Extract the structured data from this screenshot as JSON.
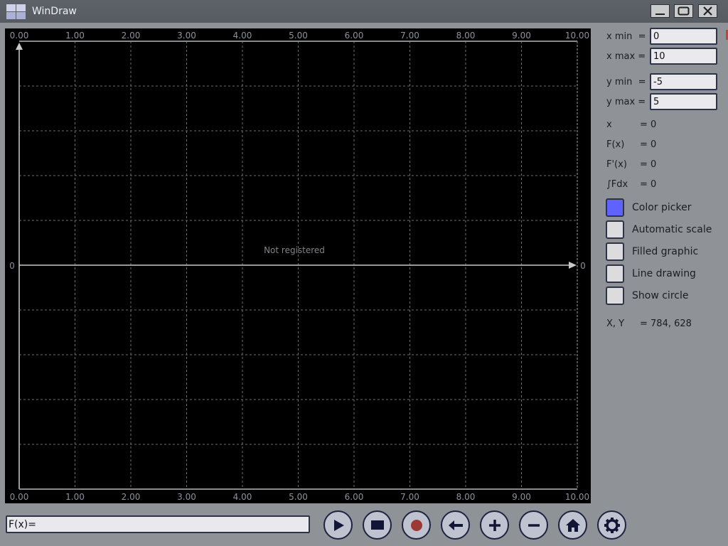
{
  "window": {
    "title": "WinDraw",
    "icon": "app-grid-icon",
    "controls": [
      {
        "name": "minimize",
        "icon": "minimize-icon"
      },
      {
        "name": "maximize",
        "icon": "maximize-icon"
      },
      {
        "name": "close",
        "icon": "close-icon"
      }
    ]
  },
  "plot": {
    "watermark": "Not registered",
    "x_ticks_top": [
      "0.00",
      "1.00",
      "2.00",
      "3.00",
      "4.00",
      "5.00",
      "6.00",
      "7.00",
      "8.00",
      "9.00",
      "10.00"
    ],
    "x_ticks_bottom": [
      "0.00",
      "1.00",
      "2.00",
      "3.00",
      "4.00",
      "5.00",
      "6.00",
      "7.00",
      "8.00",
      "9.00",
      "10.00"
    ],
    "y_axis_label_left": "0",
    "y_axis_label_right": "0",
    "colors": {
      "background": "#000000",
      "grid": "#6b6b6b",
      "axis": "#c8c8c8",
      "tick_text": "#8b929c"
    }
  },
  "chart_data": {
    "type": "line",
    "title": "",
    "xlabel": "",
    "ylabel": "",
    "xlim": [
      0,
      10
    ],
    "ylim": [
      -5,
      5
    ],
    "x_ticks": [
      0,
      1,
      2,
      3,
      4,
      5,
      6,
      7,
      8,
      9,
      10
    ],
    "y_gridlines": 10,
    "grid": true,
    "series": [],
    "annotations": [
      "Not registered"
    ]
  },
  "range": {
    "x_min": {
      "label": "x min  =",
      "value": "0"
    },
    "x_max": {
      "label": "x max =",
      "value": "10"
    },
    "y_min": {
      "label": "y min  =",
      "value": "-5"
    },
    "y_max": {
      "label": "y max =",
      "value": "5"
    }
  },
  "readouts": [
    {
      "label": "x",
      "value": "= 0"
    },
    {
      "label": "F(x)",
      "value": "= 0"
    },
    {
      "label": "F'(x)",
      "value": "= 0"
    },
    {
      "label": "∫Fdx",
      "value": "= 0"
    }
  ],
  "options": [
    {
      "label": "Color picker",
      "checked": true,
      "color": "#6062ff"
    },
    {
      "label": "Automatic scale",
      "checked": false
    },
    {
      "label": "Filled graphic",
      "checked": false
    },
    {
      "label": "Line drawing",
      "checked": false
    },
    {
      "label": "Show circle",
      "checked": false
    }
  ],
  "cursor": {
    "label": "X, Y",
    "value": "= 784, 628"
  },
  "formula": {
    "value": "F(x)="
  },
  "toolbar": [
    {
      "name": "play",
      "icon": "play-icon"
    },
    {
      "name": "stop",
      "icon": "stop-icon"
    },
    {
      "name": "record",
      "icon": "record-icon",
      "color": "#9b3a34"
    },
    {
      "name": "back",
      "icon": "arrow-left-icon"
    },
    {
      "name": "zoom-in",
      "icon": "plus-icon"
    },
    {
      "name": "zoom-out",
      "icon": "minus-icon"
    },
    {
      "name": "home",
      "icon": "home-icon"
    },
    {
      "name": "settings",
      "icon": "gear-icon"
    }
  ]
}
